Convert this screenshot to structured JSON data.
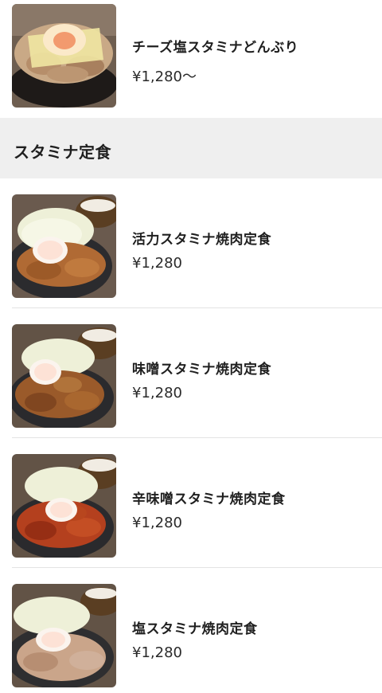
{
  "top_item": {
    "name": "チーズ塩スタミナどんぶり",
    "price": "¥1,280〜"
  },
  "section": {
    "title": "スタミナ定食"
  },
  "items": [
    {
      "name": "活力スタミナ焼肉定食",
      "price": "¥1,280"
    },
    {
      "name": "味噌スタミナ焼肉定食",
      "price": "¥1,280"
    },
    {
      "name": "辛味噌スタミナ焼肉定食",
      "price": "¥1,280"
    },
    {
      "name": "塩スタミナ焼肉定食",
      "price": "¥1,280"
    }
  ]
}
